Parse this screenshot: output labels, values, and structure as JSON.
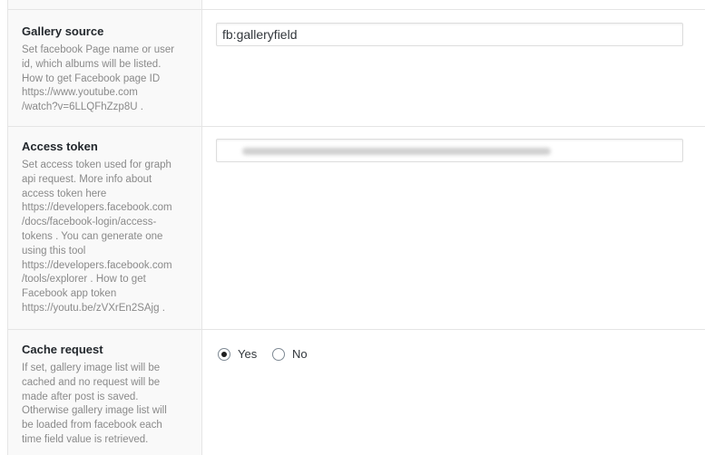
{
  "fields": {
    "gallery_source": {
      "title": "Gallery source",
      "description_lines": [
        "Set facebook Page name or user",
        "id, which albums will be listed.",
        "How to get Facebook page ID",
        "https://www.youtube.com",
        "/watch?v=6LLQFhZzp8U ."
      ],
      "value": "fb:galleryfield"
    },
    "access_token": {
      "title": "Access token",
      "description_lines": [
        "Set access token used for graph",
        "api request. More info about",
        "access token here",
        "https://developers.facebook.com",
        "/docs/facebook-login/access-",
        "tokens . You can generate one",
        "using this tool",
        "https://developers.facebook.com",
        "/tools/explorer . How to get",
        "Facebook app token",
        "https://youtu.be/zVXrEn2SAjg ."
      ],
      "value": ""
    },
    "cache_request": {
      "title": "Cache request",
      "description_lines": [
        "If set, gallery image list will be",
        "cached and no request will be",
        "made after post is saved.",
        "Otherwise gallery image list will",
        "be loaded from facebook each",
        "time field value is retrieved."
      ],
      "options": [
        "Yes",
        "No"
      ],
      "selected": "Yes"
    }
  }
}
